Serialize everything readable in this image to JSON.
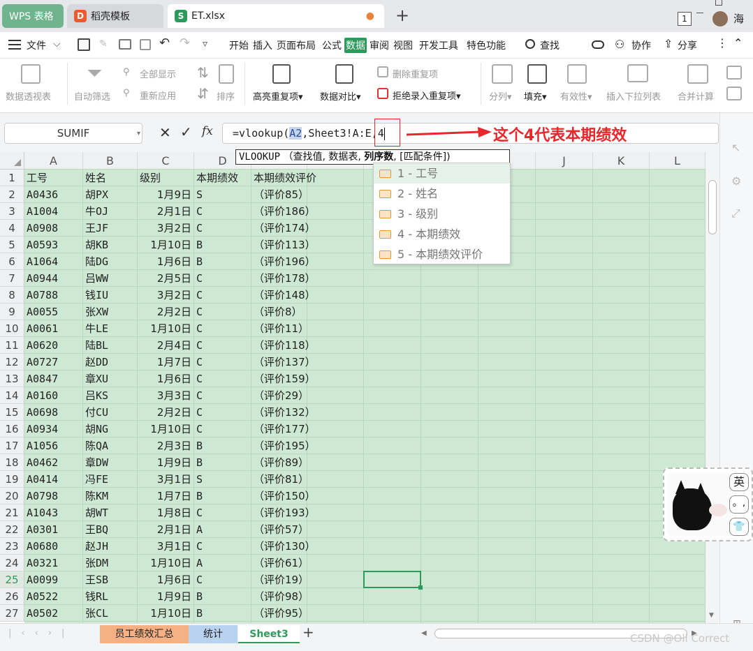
{
  "titlebar": {
    "tab_wps": "WPS 表格",
    "tab_template": "稻壳模板",
    "tab_file": "ET.xlsx",
    "new_tab": "+",
    "badge": "1",
    "user": "海"
  },
  "menu": {
    "file": "文件",
    "items": [
      "开始",
      "插入",
      "页面布局",
      "公式",
      "数据",
      "审阅",
      "视图",
      "开发工具",
      "特色功能"
    ],
    "active": "数据",
    "search": "查找",
    "collab": "协作",
    "share": "分享"
  },
  "ribbon": {
    "pivot": "数据透视表",
    "autofilter": "自动筛选",
    "show_all": "全部显示",
    "reapply": "重新应用",
    "sort": "排序",
    "highlight_dup": "高亮重复项",
    "compare": "数据对比",
    "delete_dup": "删除重复项",
    "reject_dup": "拒绝录入重复项",
    "split": "分列",
    "fill": "填充",
    "validity": "有效性",
    "insert_dropdown": "插入下拉列表",
    "merge_calc": "合并计算"
  },
  "formula_bar": {
    "name_box": "SUMIF",
    "formula_prefix": "=vlookup(",
    "formula_ref": "A2",
    "formula_rest": ",Sheet3!A:E,",
    "formula_last": "4",
    "annotation": "这个4代表本期绩效",
    "annotation_color": "#e8262b"
  },
  "tooltip": {
    "func": "VLOOKUP",
    "args_pre": "（查找值, 数据表, ",
    "args_bold": "列序数",
    "args_post": ", [匹配条件])"
  },
  "dropdown": [
    {
      "label": "1 - 工号"
    },
    {
      "label": "2 - 姓名"
    },
    {
      "label": "3 - 级别"
    },
    {
      "label": "4 - 本期绩效"
    },
    {
      "label": "5 - 本期绩效评价"
    }
  ],
  "columns": [
    "A",
    "B",
    "C",
    "D",
    "E",
    "F",
    "G",
    "H",
    "I",
    "J",
    "K",
    "L"
  ],
  "headers": [
    "工号",
    "姓名",
    "级别",
    "本期绩效",
    "本期绩效评价"
  ],
  "rows": [
    [
      "A0436",
      "胡PX",
      "1月9日",
      "S",
      "（评价85）"
    ],
    [
      "A1004",
      "牛OJ",
      "2月1日",
      "C",
      "（评价186）"
    ],
    [
      "A0908",
      "王JF",
      "3月2日",
      "C",
      "（评价174）"
    ],
    [
      "A0593",
      "胡KB",
      "1月10日",
      "B",
      "（评价113）"
    ],
    [
      "A1064",
      "陆DG",
      "1月6日",
      "B",
      "（评价196）"
    ],
    [
      "A0944",
      "吕WW",
      "2月5日",
      "C",
      "（评价178）"
    ],
    [
      "A0788",
      "钱IU",
      "3月2日",
      "C",
      "（评价148）"
    ],
    [
      "A0055",
      "张XW",
      "2月2日",
      "C",
      "（评价8）"
    ],
    [
      "A0061",
      "牛LE",
      "1月10日",
      "C",
      "（评价11）"
    ],
    [
      "A0620",
      "陆BL",
      "2月4日",
      "C",
      "（评价118）"
    ],
    [
      "A0727",
      "赵DD",
      "1月7日",
      "C",
      "（评价137）"
    ],
    [
      "A0847",
      "章XU",
      "1月6日",
      "C",
      "（评价159）"
    ],
    [
      "A0160",
      "吕KS",
      "3月3日",
      "C",
      "（评价29）"
    ],
    [
      "A0698",
      "付CU",
      "2月2日",
      "C",
      "（评价132）"
    ],
    [
      "A0934",
      "胡NG",
      "1月10日",
      "C",
      "（评价177）"
    ],
    [
      "A1056",
      "陈QA",
      "2月3日",
      "B",
      "（评价195）"
    ],
    [
      "A0462",
      "章DW",
      "1月9日",
      "B",
      "（评价89）"
    ],
    [
      "A0414",
      "冯FE",
      "3月1日",
      "S",
      "（评价81）"
    ],
    [
      "A0798",
      "陈KM",
      "1月7日",
      "B",
      "（评价150）"
    ],
    [
      "A1043",
      "胡WT",
      "1月8日",
      "C",
      "（评价193）"
    ],
    [
      "A0301",
      "王BQ",
      "2月1日",
      "A",
      "（评价57）"
    ],
    [
      "A0680",
      "赵JH",
      "3月1日",
      "C",
      "（评价130）"
    ],
    [
      "A0321",
      "张DM",
      "1月10日",
      "A",
      "（评价61）"
    ],
    [
      "A0099",
      "王SB",
      "1月6日",
      "C",
      "（评价19）"
    ],
    [
      "A0522",
      "钱RL",
      "1月9日",
      "B",
      "（评价98）"
    ],
    [
      "A0502",
      "张CL",
      "1月10日",
      "B",
      "（评价95）"
    ]
  ],
  "sheets": [
    "员工绩效汇总",
    "统计",
    "Sheet3"
  ],
  "active_sheet": "Sheet3",
  "ime": {
    "lang": "英",
    "punct": "。,"
  },
  "watermark": "CSDN @Oll Correct",
  "colors": {
    "grid_fill": "#cde8d3",
    "accent": "#2b9a5b",
    "sheet_tab_orange": "#f5b183",
    "sheet_tab_blue": "#b8d2ef"
  }
}
